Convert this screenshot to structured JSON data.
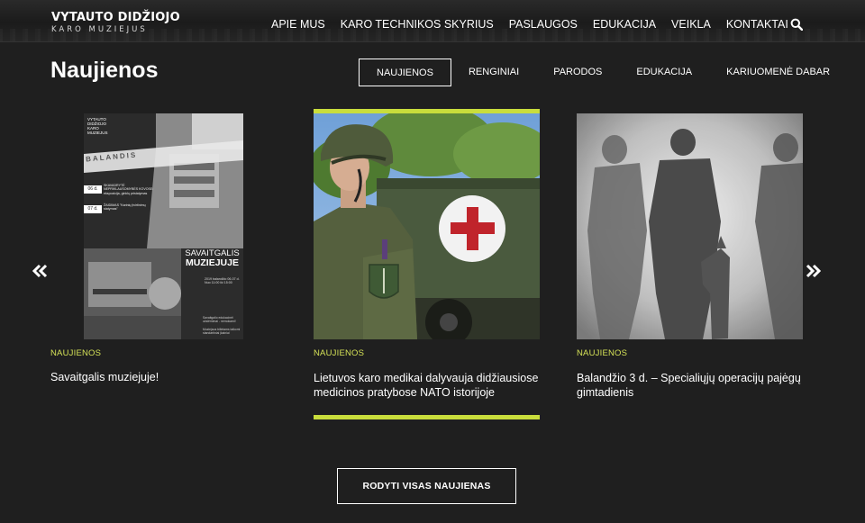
{
  "header": {
    "logo_main": "VYTAUTO DIDŽIOJO",
    "logo_sub": "KARO MUZIEJUS",
    "nav": [
      "APIE MUS",
      "KARO TECHNIKOS SKYRIUS",
      "PASLAUGOS",
      "EDUKACIJA",
      "VEIKLA",
      "KONTAKTAI"
    ]
  },
  "section": {
    "title": "Naujienos",
    "tabs": [
      "NAUJIENOS",
      "RENGINIAI",
      "PARODOS",
      "EDUKACIJA",
      "KARIUOMENĖ DABAR"
    ],
    "active_tab": "NAUJIENOS"
  },
  "poster": {
    "logo_lines": [
      "VYTAUTO",
      "DIDŽIOJO",
      "KARO",
      "MUZIEJUS"
    ],
    "month": "BALANDIS",
    "event1_day": "06 d.",
    "event1_text": "SKAVADRYTĖ NEPRIKLAUSOMYBĖS KOVOSE: ekspozicija, ginklų pristatymas",
    "event2_day": "07 d.",
    "event2_text": "ŽAIDIMAS \"Karinių įtvirtinimų statymas\"",
    "headline_1": "SAVAITGALIS",
    "headline_2": "MUZIEJUJE",
    "schedule": "2019 balandžio 06-07 d. Nuo 11:00 iki 15:00",
    "footer_1": "Savaitgalio edukacinėi užsiėmimai - nemokami!",
    "footer_2": "Muziejaus bilietams taikomi standartiniai įkainiai"
  },
  "cards": [
    {
      "category": "NAUJIENOS",
      "title": "Savaitgalis muziejuje!"
    },
    {
      "category": "NAUJIENOS",
      "title": "Lietuvos karo medikai dalyvauja didžiausiose medicinos pratybose NATO istorijoje"
    },
    {
      "category": "NAUJIENOS",
      "title": "Balandžio 3 d. – Specialiųjų operacijų pajėgų gimtadienis"
    }
  ],
  "more_button": "RODYTI VISAS NAUJIENAS",
  "colors": {
    "accent": "#c9dd3c",
    "category_text": "#d4e157",
    "background": "#1f1f1f"
  },
  "icons": [
    "search-icon",
    "chevrons-left-icon",
    "chevrons-right-icon"
  ]
}
